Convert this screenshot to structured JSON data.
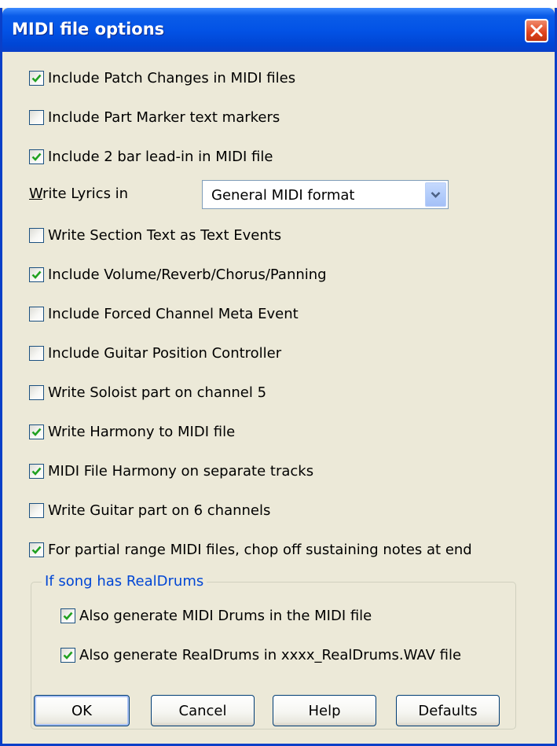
{
  "window": {
    "title": "MIDI file options"
  },
  "options": [
    {
      "label": "Include Patch Changes in MIDI files",
      "checked": true
    },
    {
      "label": "Include Part Marker text  markers",
      "checked": false
    },
    {
      "label": "Include 2 bar lead-in in MIDI file",
      "checked": true
    },
    {
      "label": "Write Section Text as Text Events",
      "checked": false
    },
    {
      "label": "Include Volume/Reverb/Chorus/Panning",
      "checked": true
    },
    {
      "label": "Include Forced Channel Meta Event",
      "checked": false
    },
    {
      "label": "Include Guitar Position Controller",
      "checked": false
    },
    {
      "label": "Write Soloist part on channel 5",
      "checked": false
    },
    {
      "label": "Write Harmony to MIDI file",
      "checked": true
    },
    {
      "label": "MIDI File Harmony on separate tracks",
      "checked": true
    },
    {
      "label": "Write Guitar part on 6 channels",
      "checked": false
    },
    {
      "label": "For partial range MIDI files, chop off sustaining notes at end",
      "checked": true
    }
  ],
  "lyrics": {
    "label_accel": "W",
    "label_rest": "rite Lyrics in",
    "selected": "General MIDI format"
  },
  "realdrums_group": {
    "title": "If song has RealDrums",
    "options": [
      {
        "label": "Also generate MIDI Drums in the MIDI file",
        "checked": true
      },
      {
        "label": "Also generate RealDrums in xxxx_RealDrums.WAV file",
        "checked": true
      }
    ]
  },
  "buttons": {
    "ok": "OK",
    "cancel": "Cancel",
    "help": "Help",
    "defaults": "Defaults"
  },
  "colors": {
    "title_bar": "#0353e6",
    "dialog_bg": "#ece9d8",
    "checkmark": "#21a121",
    "group_title": "#0046d5"
  }
}
